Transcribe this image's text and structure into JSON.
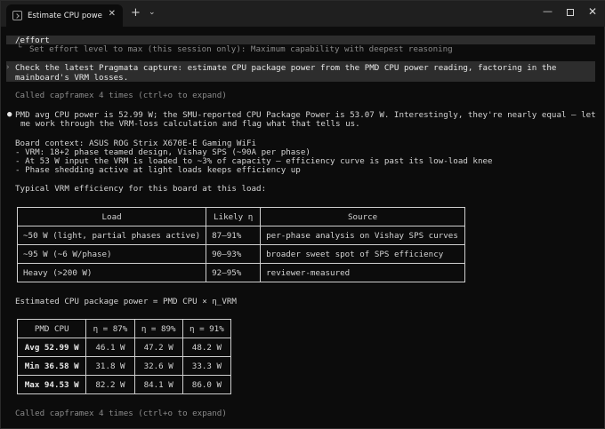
{
  "window": {
    "tab_title": "Estimate CPU power from",
    "tab_close": "✕",
    "new_tab": "+",
    "dropdown": "⌄",
    "minimize": "—",
    "close": "✕"
  },
  "transcript": {
    "effort_command": "/effort",
    "effort_result": "Set effort level to max (this session only): Maximum capability with deepest reasoning",
    "user_prompt_line1": "Check the latest Pragmata capture: estimate CPU package power from the PMD CPU power reading, factoring in the",
    "user_prompt_line2": "mainboard's VRM losses.",
    "tool_call_1": "Called capframex 4 times (ctrl+o to expand)",
    "answer_line1": "PMD avg CPU power is 52.99 W; the SMU-reported CPU Package Power is 53.07 W. Interestingly, they're nearly equal — let",
    "answer_line2": "me work through the VRM-loss calculation and flag what that tells us.",
    "board_context": "Board context: ASUS ROG Strix X670E-E Gaming WiFi",
    "board_item1": "- VRM: 18+2 phase teamed design, Vishay SPS (~90A per phase)",
    "board_item2": "- At 53 W input the VRM is loaded to ~3% of capacity — efficiency curve is past its low-load knee",
    "board_item3": "- Phase shedding active at light loads keeps efficiency up",
    "efficiency_heading": "Typical VRM efficiency for this board at this load:",
    "formula_heading": "Estimated CPU package power = PMD CPU × η_VRM",
    "tool_call_2": "Called capframex 4 times (ctrl+o to expand)"
  },
  "efficiency_table": {
    "headers": [
      "Load",
      "Likely η",
      "Source"
    ],
    "rows": [
      [
        "~50 W (light, partial phases active)",
        "87–91%",
        "per-phase analysis on Vishay SPS curves"
      ],
      [
        "~95 W (~6 W/phase)",
        "90–93%",
        "broader sweet spot of SPS efficiency"
      ],
      [
        "Heavy (>200 W)",
        "92–95%",
        "reviewer-measured"
      ]
    ]
  },
  "power_table": {
    "headers": [
      "PMD CPU",
      "η = 87%",
      "η = 89%",
      "η = 91%"
    ],
    "rows": [
      [
        "Avg 52.99 W",
        "46.1 W",
        "47.2 W",
        "48.2 W"
      ],
      [
        "Min 36.58 W",
        "31.8 W",
        "32.6 W",
        "33.3 W"
      ],
      [
        "Max 94.53 W",
        "82.2 W",
        "84.1 W",
        "86.0 W"
      ]
    ]
  }
}
